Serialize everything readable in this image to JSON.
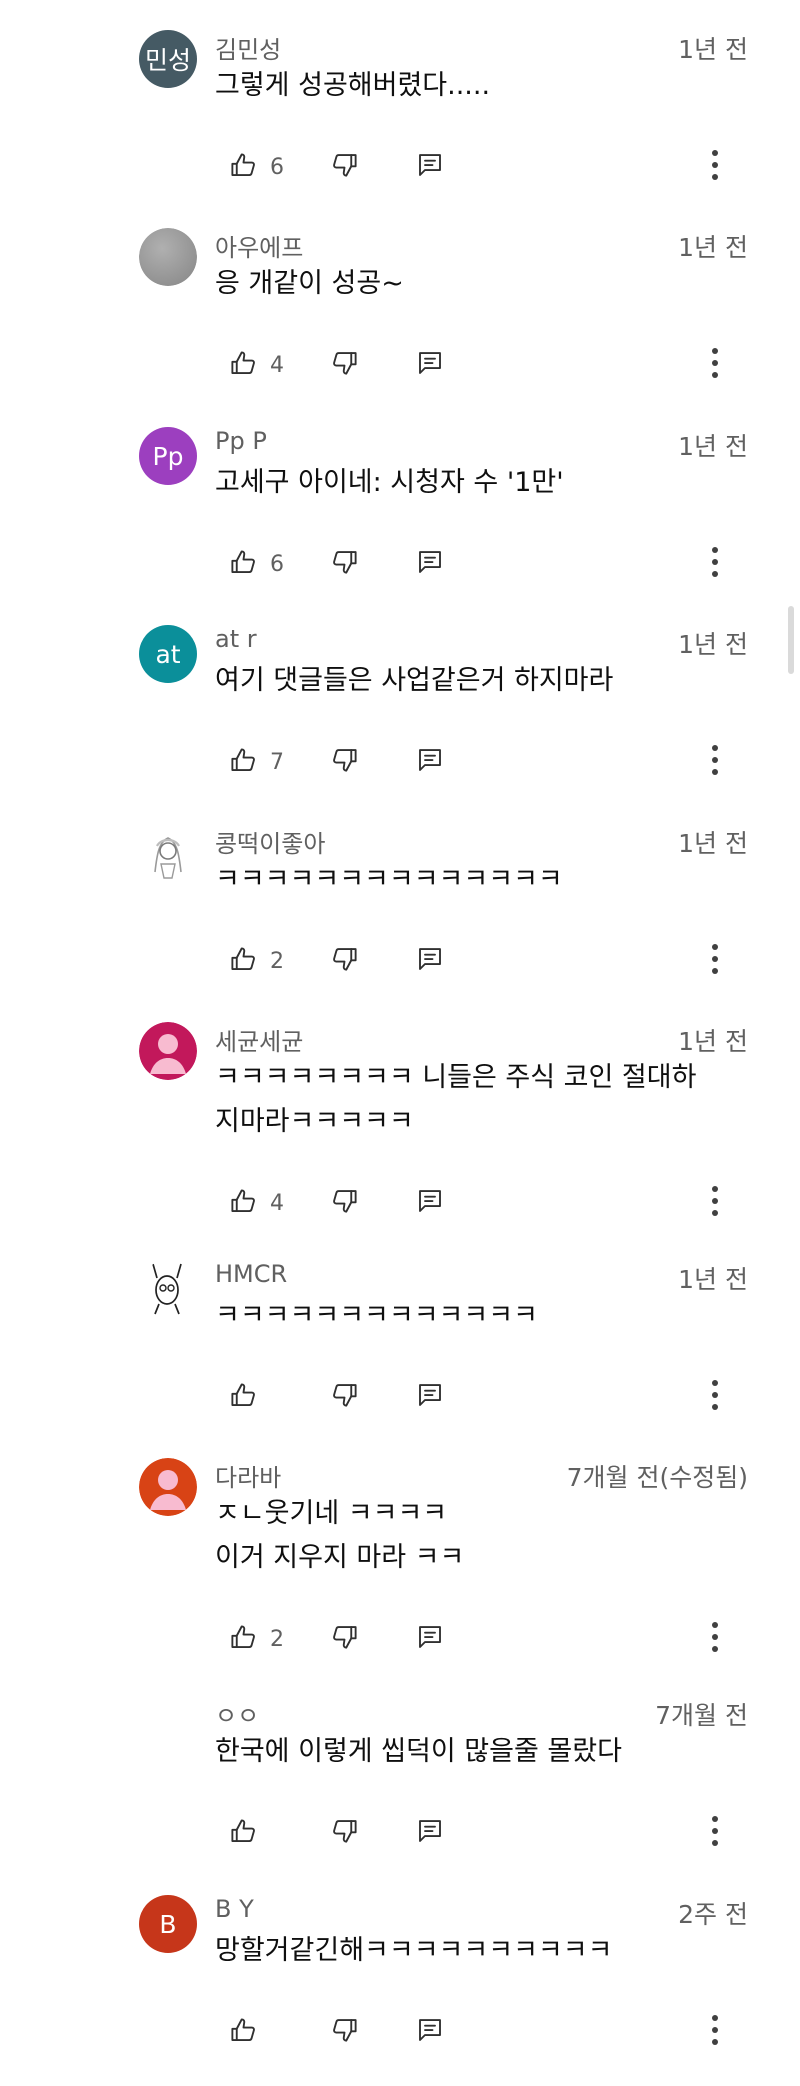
{
  "comments": [
    {
      "author": "김민성",
      "time": "1년 전",
      "text_lines": [
        "그렇게 성공해버렸다....."
      ],
      "likes": "6",
      "avatar": {
        "type": "initials",
        "text": "민성",
        "color": "#455a64"
      }
    },
    {
      "author": "아우에프",
      "time": "1년 전",
      "text_lines": [
        "응 개같이 성공~"
      ],
      "likes": "4",
      "avatar": {
        "type": "gray-circle",
        "color": "#8e8e8e"
      }
    },
    {
      "author": "Pp P",
      "time": "1년 전",
      "text_lines": [
        "고세구 아이네: 시청자 수 '1만'"
      ],
      "likes": "6",
      "avatar": {
        "type": "initials",
        "text": "Pp",
        "color": "#9c3fbf"
      }
    },
    {
      "author": "at r",
      "time": "1년 전",
      "text_lines": [
        "여기 댓글들은 사업같은거 하지마라"
      ],
      "likes": "7",
      "avatar": {
        "type": "initials",
        "text": "at",
        "color": "#0b8f9a"
      }
    },
    {
      "author": "콩떡이좋아",
      "time": "1년 전",
      "text_lines": [
        "ㅋㅋㅋㅋㅋㅋㅋㅋㅋㅋㅋㅋㅋㅋ"
      ],
      "likes": "2",
      "avatar": {
        "type": "drawing"
      }
    },
    {
      "author": "세균세균",
      "time": "1년 전",
      "text_lines": [
        "ㅋㅋㅋㅋㅋㅋㅋㅋ 니들은 주식 코인 절대하",
        "지마라ㅋㅋㅋㅋㅋ"
      ],
      "likes": "4",
      "avatar": {
        "type": "person",
        "color": "#c2185b"
      }
    },
    {
      "author": "HMCR",
      "time": "1년 전",
      "text_lines": [
        "ㅋㅋㅋㅋㅋㅋㅋㅋㅋㅋㅋㅋㅋ"
      ],
      "likes": "",
      "avatar": {
        "type": "sketch"
      }
    },
    {
      "author": "다라바",
      "time": "7개월 전(수정됨)",
      "text_lines": [
        "ㅈㄴ웃기네 ㅋㅋㅋㅋ",
        "이거 지우지 마라 ㅋㅋ"
      ],
      "likes": "2",
      "avatar": {
        "type": "person",
        "color": "#d84315"
      }
    },
    {
      "author": "ㅇㅇ",
      "time": "7개월 전",
      "text_lines": [
        "한국에 이렇게 씹덕이 많을줄 몰랐다"
      ],
      "likes": "",
      "avatar": {
        "type": "none"
      }
    },
    {
      "author": "B Y",
      "time": "2주 전",
      "text_lines": [
        "망할거같긴해ㅋㅋㅋㅋㅋㅋㅋㅋㅋㅋ"
      ],
      "likes": "",
      "avatar": {
        "type": "initials",
        "text": "B",
        "color": "#c6361a"
      }
    }
  ],
  "icons": {
    "like": "thumbs-up-icon",
    "dislike": "thumbs-down-icon",
    "reply": "reply-icon",
    "more": "more-vert-icon"
  },
  "colors": {
    "secondary_text": "#606060",
    "primary_text": "#0f0f0f",
    "icon": "#303030",
    "scrollbar": "#dadada"
  }
}
